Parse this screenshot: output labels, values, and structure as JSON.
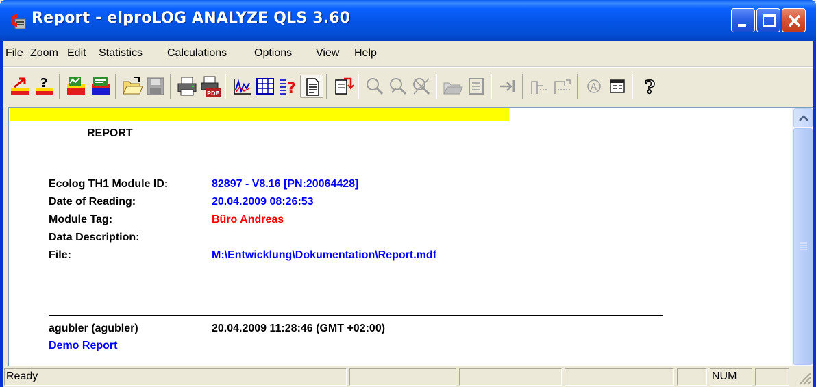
{
  "window": {
    "title": "Report - elproLOG ANALYZE QLS 3.60",
    "app_icon": "elpro-app-icon",
    "title_bar_color": "#0a5ef2"
  },
  "menu": [
    "File",
    "Zoom",
    "Edit",
    "Statistics",
    "Calculations",
    "Options",
    "View",
    "Help"
  ],
  "toolbar": {
    "icons": [
      "export-red-icon",
      "help-query-icon",
      "chart-wizard-icon",
      "chart-edit-icon",
      "open-folder-icon",
      "save-disk-icon",
      "print-icon",
      "pdf-icon",
      "graph-icon",
      "table-icon",
      "info-icon",
      "report-icon",
      "export-icon",
      "zoom-in-icon",
      "zoom-area-icon",
      "zoom-reset-icon",
      "open-icon",
      "save-icon",
      "goto-end-icon",
      "mark-start-icon",
      "mark-end-icon",
      "annotation-icon",
      "properties-icon",
      "help-icon"
    ]
  },
  "report": {
    "heading": "REPORT",
    "highlight_color": "#ffff00",
    "fields": [
      {
        "label": "Ecolog TH1 Module ID:",
        "value": "82897 - V8.16 [PN:20064428]",
        "color": "#0000ff"
      },
      {
        "label": "Date of Reading:",
        "value": "20.04.2009  08:26:53",
        "color": "#0000ff"
      },
      {
        "label": "Module Tag:",
        "value": "Büro Andreas",
        "color": "#ff0000"
      },
      {
        "label": "Data Description:",
        "value": "",
        "color": "#0000ff"
      },
      {
        "label": "File:",
        "value": "M:\\Entwicklung\\Dokumentation\\Report.mdf",
        "color": "#0000ff"
      }
    ],
    "footer": {
      "user": "agubler (agubler)",
      "timestamp": "20.04.2009  11:28:46   (GMT +02:00)",
      "report_name": "Demo Report"
    }
  },
  "status": {
    "text": "Ready",
    "num": "NUM"
  }
}
